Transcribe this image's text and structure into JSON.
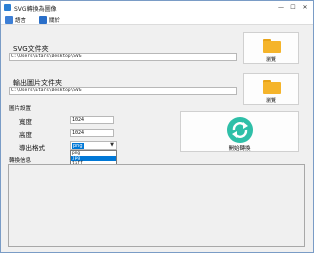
{
  "window": {
    "title": "SVG轉換為圖像",
    "minimize": "—",
    "maximize": "☐",
    "close": "✕"
  },
  "menu": {
    "items": [
      {
        "label": "語言",
        "icon": "translate-icon"
      },
      {
        "label": "關於",
        "icon": "info-icon"
      }
    ]
  },
  "svg_folder": {
    "label": "SVG文件夾",
    "path": "C:\\Users\\Etars\\Desktop\\SVG",
    "browse_label": "瀏覽"
  },
  "output_folder": {
    "label": "輸出圖片文件夾",
    "path": "C:\\Users\\Etars\\Desktop\\SVG",
    "browse_label": "瀏覽"
  },
  "image_settings": {
    "group_label": "圖片設置",
    "width_label": "寬度",
    "width_value": "1024",
    "height_label": "高度",
    "height_value": "1024",
    "format_label": "導出格式",
    "format_selected": "png",
    "format_options": [
      "png",
      "jpg",
      "tiff",
      "bmp"
    ],
    "format_highlighted": "jpg"
  },
  "actions": {
    "start_label": "開始轉換"
  },
  "log": {
    "label": "轉換信息"
  },
  "colors": {
    "accent": "#0078d7",
    "folder": "#f5b42a",
    "convert_icon": "#2fbfa8"
  }
}
